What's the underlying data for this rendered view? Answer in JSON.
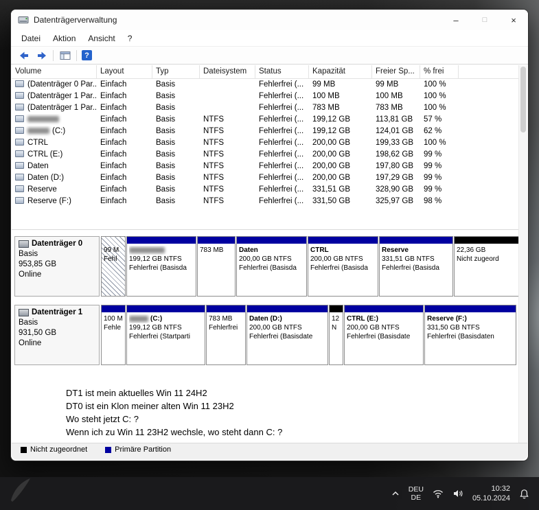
{
  "window": {
    "title": "Datenträgerverwaltung",
    "menu": [
      "Datei",
      "Aktion",
      "Ansicht",
      "?"
    ],
    "titlebar_icons": {
      "minimize": "–",
      "maximize": "□",
      "close": "×"
    }
  },
  "toolbar": {
    "help_glyph": "?",
    "icon_names": [
      "back",
      "forward",
      "console-tree",
      "help"
    ]
  },
  "table": {
    "columns": [
      "Volume",
      "Layout",
      "Typ",
      "Dateisystem",
      "Status",
      "Kapazität",
      "Freier Sp...",
      "% frei"
    ],
    "rows": [
      {
        "volume": "(Datenträger 0 Par...",
        "layout": "Einfach",
        "typ": "Basis",
        "fs": "",
        "status": "Fehlerfrei (...",
        "cap": "99 MB",
        "free": "99 MB",
        "pct": "100 %"
      },
      {
        "volume": "(Datenträger 1 Par...",
        "layout": "Einfach",
        "typ": "Basis",
        "fs": "",
        "status": "Fehlerfrei (...",
        "cap": "100 MB",
        "free": "100 MB",
        "pct": "100 %"
      },
      {
        "volume": "(Datenträger 1 Par...",
        "layout": "Einfach",
        "typ": "Basis",
        "fs": "",
        "status": "Fehlerfrei (...",
        "cap": "783 MB",
        "free": "783 MB",
        "pct": "100 %"
      },
      {
        "volume": "",
        "redacted": true,
        "layout": "Einfach",
        "typ": "Basis",
        "fs": "NTFS",
        "status": "Fehlerfrei (...",
        "cap": "199,12 GB",
        "free": "113,81 GB",
        "pct": "57 %"
      },
      {
        "volume": "(C:)",
        "redacted": true,
        "layout": "Einfach",
        "typ": "Basis",
        "fs": "NTFS",
        "status": "Fehlerfrei (...",
        "cap": "199,12 GB",
        "free": "124,01 GB",
        "pct": "62 %"
      },
      {
        "volume": "CTRL",
        "layout": "Einfach",
        "typ": "Basis",
        "fs": "NTFS",
        "status": "Fehlerfrei (...",
        "cap": "200,00 GB",
        "free": "199,33 GB",
        "pct": "100 %"
      },
      {
        "volume": "CTRL (E:)",
        "layout": "Einfach",
        "typ": "Basis",
        "fs": "NTFS",
        "status": "Fehlerfrei (...",
        "cap": "200,00 GB",
        "free": "198,62 GB",
        "pct": "99 %"
      },
      {
        "volume": "Daten",
        "layout": "Einfach",
        "typ": "Basis",
        "fs": "NTFS",
        "status": "Fehlerfrei (...",
        "cap": "200,00 GB",
        "free": "197,80 GB",
        "pct": "99 %"
      },
      {
        "volume": "Daten (D:)",
        "layout": "Einfach",
        "typ": "Basis",
        "fs": "NTFS",
        "status": "Fehlerfrei (...",
        "cap": "200,00 GB",
        "free": "197,29 GB",
        "pct": "99 %"
      },
      {
        "volume": "Reserve",
        "layout": "Einfach",
        "typ": "Basis",
        "fs": "NTFS",
        "status": "Fehlerfrei (...",
        "cap": "331,51 GB",
        "free": "328,90 GB",
        "pct": "99 %"
      },
      {
        "volume": "Reserve (F:)",
        "layout": "Einfach",
        "typ": "Basis",
        "fs": "NTFS",
        "status": "Fehlerfrei (...",
        "cap": "331,50 GB",
        "free": "325,97 GB",
        "pct": "98 %"
      }
    ]
  },
  "disks": [
    {
      "name": "Datenträger 0",
      "type": "Basis",
      "size": "953,85 GB",
      "status": "Online",
      "partitions": [
        {
          "l1": "99 M",
          "l2": "Fehl",
          "l3": "",
          "style": "selected-hatched"
        },
        {
          "l1": "",
          "redacted": true,
          "l2": "199,12 GB NTFS",
          "l3": "Fehlerfrei (Basisda"
        },
        {
          "l1": "783 MB",
          "l2": "",
          "l3": ""
        },
        {
          "l1": "Daten",
          "l2": "200,00 GB NTFS",
          "l3": "Fehlerfrei (Basisda"
        },
        {
          "l1": "CTRL",
          "l2": "200,00 GB NTFS",
          "l3": "Fehlerfrei (Basisda"
        },
        {
          "l1": "Reserve",
          "l2": "331,51 GB NTFS",
          "l3": "Fehlerfrei (Basisda"
        },
        {
          "l1": "22,36 GB",
          "l2": "Nicht zugeord",
          "l3": "",
          "style": "unallocated"
        }
      ]
    },
    {
      "name": "Datenträger 1",
      "type": "Basis",
      "size": "931,50 GB",
      "status": "Online",
      "partitions": [
        {
          "l1": "100 M",
          "l2": "Fehle",
          "l3": ""
        },
        {
          "l1": "(C:)",
          "redacted": true,
          "l2": "199,12 GB NTFS",
          "l3": "Fehlerfrei (Startparti"
        },
        {
          "l1": "783 MB",
          "l2": "Fehlerfrei",
          "l3": ""
        },
        {
          "l1": "Daten (D:)",
          "l2": "200,00 GB NTFS",
          "l3": "Fehlerfrei (Basisdate"
        },
        {
          "l1": "12",
          "l2": "N",
          "l3": "",
          "style": "unallocated"
        },
        {
          "l1": "CTRL (E:)",
          "l2": "200,00 GB NTFS",
          "l3": "Fehlerfrei (Basisdate"
        },
        {
          "l1": "Reserve (F:)",
          "l2": "331,50 GB NTFS",
          "l3": "Fehlerfrei (Basisdaten"
        }
      ]
    }
  ],
  "annotation": {
    "lines": [
      "DT1 ist mein aktuelles Win 11 24H2",
      "DT0 ist ein Klon meiner alten Win 11 23H2",
      "Wo steht jetzt C: ?",
      "Wenn ich zu Win 11 23H2 wechsle, wo steht dann C: ?"
    ]
  },
  "legend": {
    "items": [
      {
        "label": "Nicht zugeordnet",
        "color": "#000000"
      },
      {
        "label": "Primäre Partition",
        "color": "#0000a0"
      }
    ]
  },
  "taskbar": {
    "language": {
      "primary": "DEU",
      "secondary": "DE"
    },
    "clock": {
      "time": "10:32",
      "date": "05.10.2024"
    }
  },
  "colors": {
    "primary_partition": "#0000a0",
    "unallocated": "#000000"
  }
}
